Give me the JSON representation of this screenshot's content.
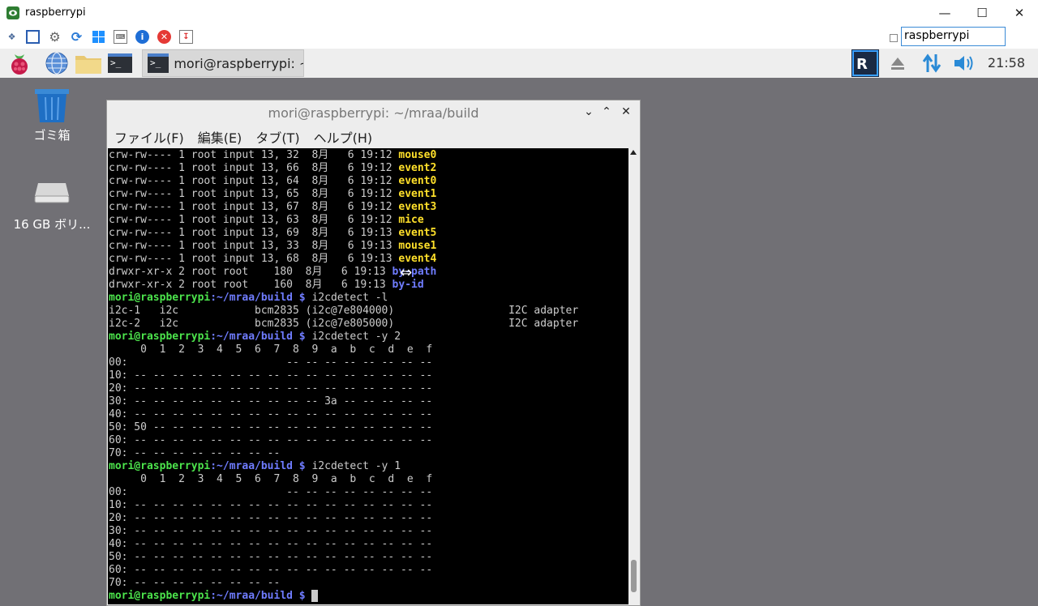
{
  "vnc": {
    "title": "raspberrypi",
    "address": "raspberrypi",
    "window_buttons": [
      "minimize-icon",
      "maximize-icon",
      "close-icon"
    ]
  },
  "panel": {
    "task_label": "mori@raspberrypi: ~/...",
    "clock": "21:58",
    "tray_icons": [
      "vnc-icon",
      "eject-icon",
      "network-icon",
      "volume-icon"
    ]
  },
  "desktop": {
    "trash_label": "ゴミ箱",
    "drive_label": "16 GB ボリ..."
  },
  "terminal": {
    "title": "mori@raspberrypi: ~/mraa/build",
    "menu": [
      "ファイル(F)",
      "編集(E)",
      "タブ(T)",
      "ヘルプ(H)"
    ],
    "prompt_user": "mori@raspberrypi",
    "prompt_path": ":~/mraa/build $",
    "lines": [
      {
        "kind": "ls",
        "perm": "crw-rw---- 1 root input 13, 32  8月   6 19:12 ",
        "name": "mouse0",
        "type": "dev"
      },
      {
        "kind": "ls",
        "perm": "crw-rw---- 1 root input 13, 66  8月   6 19:12 ",
        "name": "event2",
        "type": "dev"
      },
      {
        "kind": "ls",
        "perm": "crw-rw---- 1 root input 13, 64  8月   6 19:12 ",
        "name": "event0",
        "type": "dev"
      },
      {
        "kind": "ls",
        "perm": "crw-rw---- 1 root input 13, 65  8月   6 19:12 ",
        "name": "event1",
        "type": "dev"
      },
      {
        "kind": "ls",
        "perm": "crw-rw---- 1 root input 13, 67  8月   6 19:12 ",
        "name": "event3",
        "type": "dev"
      },
      {
        "kind": "ls",
        "perm": "crw-rw---- 1 root input 13, 63  8月   6 19:12 ",
        "name": "mice",
        "type": "dev"
      },
      {
        "kind": "ls",
        "perm": "crw-rw---- 1 root input 13, 69  8月   6 19:13 ",
        "name": "event5",
        "type": "dev"
      },
      {
        "kind": "ls",
        "perm": "crw-rw---- 1 root input 13, 33  8月   6 19:13 ",
        "name": "mouse1",
        "type": "dev"
      },
      {
        "kind": "ls",
        "perm": "crw-rw---- 1 root input 13, 68  8月   6 19:13 ",
        "name": "event4",
        "type": "dev"
      },
      {
        "kind": "ls",
        "perm": "drwxr-xr-x 2 root root    180  8月   6 19:13 ",
        "name": "by-path",
        "type": "dir"
      },
      {
        "kind": "ls",
        "perm": "drwxr-xr-x 2 root root    160  8月   6 19:13 ",
        "name": "by-id",
        "type": "dir"
      },
      {
        "kind": "prompt",
        "cmd": " i2cdetect -l"
      },
      {
        "kind": "text",
        "text": "i2c-1   i2c            bcm2835 (i2c@7e804000)                  I2C adapter"
      },
      {
        "kind": "text",
        "text": "i2c-2   i2c            bcm2835 (i2c@7e805000)                  I2C adapter"
      },
      {
        "kind": "prompt",
        "cmd": " i2cdetect -y 2"
      },
      {
        "kind": "text",
        "text": "     0  1  2  3  4  5  6  7  8  9  a  b  c  d  e  f"
      },
      {
        "kind": "text",
        "text": "00:                         -- -- -- -- -- -- -- --"
      },
      {
        "kind": "text",
        "text": "10: -- -- -- -- -- -- -- -- -- -- -- -- -- -- -- --"
      },
      {
        "kind": "text",
        "text": "20: -- -- -- -- -- -- -- -- -- -- -- -- -- -- -- --"
      },
      {
        "kind": "text",
        "text": "30: -- -- -- -- -- -- -- -- -- -- 3a -- -- -- -- --"
      },
      {
        "kind": "text",
        "text": "40: -- -- -- -- -- -- -- -- -- -- -- -- -- -- -- --"
      },
      {
        "kind": "text",
        "text": "50: 50 -- -- -- -- -- -- -- -- -- -- -- -- -- -- --"
      },
      {
        "kind": "text",
        "text": "60: -- -- -- -- -- -- -- -- -- -- -- -- -- -- -- --"
      },
      {
        "kind": "text",
        "text": "70: -- -- -- -- -- -- -- --"
      },
      {
        "kind": "prompt",
        "cmd": " i2cdetect -y 1"
      },
      {
        "kind": "text",
        "text": "     0  1  2  3  4  5  6  7  8  9  a  b  c  d  e  f"
      },
      {
        "kind": "text",
        "text": "00:                         -- -- -- -- -- -- -- --"
      },
      {
        "kind": "text",
        "text": "10: -- -- -- -- -- -- -- -- -- -- -- -- -- -- -- --"
      },
      {
        "kind": "text",
        "text": "20: -- -- -- -- -- -- -- -- -- -- -- -- -- -- -- --"
      },
      {
        "kind": "text",
        "text": "30: -- -- -- -- -- -- -- -- -- -- -- -- -- -- -- --"
      },
      {
        "kind": "text",
        "text": "40: -- -- -- -- -- -- -- -- -- -- -- -- -- -- -- --"
      },
      {
        "kind": "text",
        "text": "50: -- -- -- -- -- -- -- -- -- -- -- -- -- -- -- --"
      },
      {
        "kind": "text",
        "text": "60: -- -- -- -- -- -- -- -- -- -- -- -- -- -- -- --"
      },
      {
        "kind": "text",
        "text": "70: -- -- -- -- -- -- -- --"
      },
      {
        "kind": "prompt",
        "cmd": " ",
        "cursor": true
      }
    ]
  },
  "colors": {
    "desktop_bg": "#717075",
    "prompt_user": "#4ce44c",
    "prompt_path": "#6f7cff",
    "device": "#ffe02a"
  }
}
